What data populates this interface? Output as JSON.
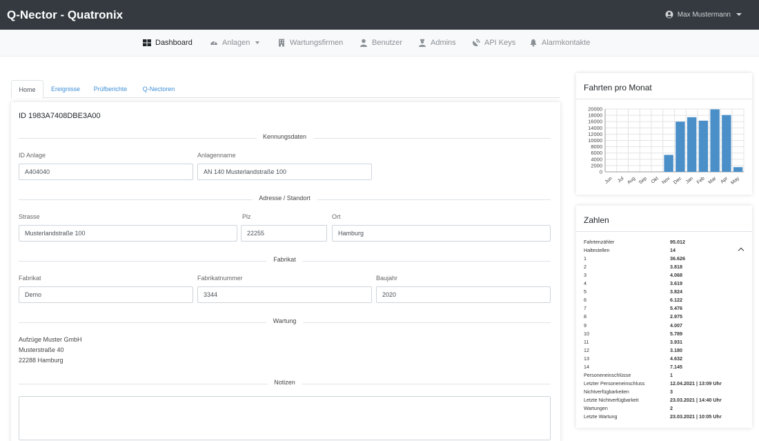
{
  "header": {
    "brand": "Q-Nector - Quatronix",
    "user_name": "Max Mustermann"
  },
  "nav": {
    "items": [
      {
        "label": "Dashboard",
        "icon": "dashboard-icon",
        "active": true
      },
      {
        "label": "Anlagen",
        "icon": "gauge-icon",
        "dropdown": true
      },
      {
        "label": "Wartungsfirmen",
        "icon": "building-icon"
      },
      {
        "label": "Benutzer",
        "icon": "user-icon"
      },
      {
        "label": "Admins",
        "icon": "admin-icon"
      },
      {
        "label": "API Keys",
        "icon": "satellite-icon"
      },
      {
        "label": "Alarmkontakte",
        "icon": "bell-icon"
      }
    ]
  },
  "tabs": [
    "Home",
    "Ereignisse",
    "Prüfberichte",
    "Q-Nectoren"
  ],
  "main": {
    "id_title": "ID 1983A7408DBE3A00",
    "sections": {
      "kennung": "Kennungsdaten",
      "adresse": "Adresse / Standort",
      "fabrikat": "Fabrikat",
      "wartung": "Wartung",
      "notizen": "Notizen"
    },
    "fields": {
      "id_anlage": {
        "label": "ID Anlage",
        "value": "A404040"
      },
      "anlagenname": {
        "label": "Anlagenname",
        "value": "AN 140 Musterlandstraße 100"
      },
      "strasse": {
        "label": "Strasse",
        "value": "Musterlandstraße 100"
      },
      "plz": {
        "label": "Plz",
        "value": "22255"
      },
      "ort": {
        "label": "Ort",
        "value": "Hamburg"
      },
      "fabrikat": {
        "label": "Fabrikat",
        "value": "Demo"
      },
      "fabrikatnummer": {
        "label": "Fabrikatnummer",
        "value": "3344"
      },
      "baujahr": {
        "label": "Baujahr",
        "value": "2020"
      }
    },
    "wartung": {
      "line1": "Aufzüge Muster GmbH",
      "line2": "Musterstraße 40",
      "line3": "22288 Hamburg"
    },
    "notizen_value": ""
  },
  "chart_card": {
    "title": "Fahrten pro Monat"
  },
  "chart_data": {
    "type": "bar",
    "categories": [
      "Jun",
      "Jul",
      "Aug",
      "Sep",
      "Okt",
      "Nov",
      "Dec",
      "Jan",
      "Feb",
      "Mar",
      "Apr",
      "May"
    ],
    "values": [
      0,
      0,
      0,
      0,
      0,
      5400,
      16000,
      17400,
      16300,
      19900,
      18100,
      1500
    ],
    "title": "",
    "xlabel": "",
    "ylabel": "",
    "ylim": [
      0,
      20000
    ],
    "yticks": [
      0,
      2000,
      4000,
      6000,
      8000,
      10000,
      12000,
      14000,
      16000,
      18000,
      20000
    ],
    "grid": true,
    "bar_color": "#4a8fc8"
  },
  "zahlen": {
    "title": "Zahlen",
    "rows": [
      {
        "k": "Fahrtenzähler",
        "v": "95.012"
      },
      {
        "k": "Haltestellen",
        "v": "14"
      },
      {
        "k": "1",
        "v": "36.626"
      },
      {
        "k": "2",
        "v": "3.818"
      },
      {
        "k": "3",
        "v": "4.068"
      },
      {
        "k": "4",
        "v": "3.619"
      },
      {
        "k": "5",
        "v": "3.824"
      },
      {
        "k": "6",
        "v": "6.122"
      },
      {
        "k": "7",
        "v": "5.476"
      },
      {
        "k": "8",
        "v": "2.975"
      },
      {
        "k": "9",
        "v": "4.007"
      },
      {
        "k": "10",
        "v": "5.789"
      },
      {
        "k": "11",
        "v": "3.931"
      },
      {
        "k": "12",
        "v": "3.180"
      },
      {
        "k": "13",
        "v": "4.632"
      },
      {
        "k": "14",
        "v": "7.145"
      },
      {
        "k": "Personeneinschlüsse",
        "v": "1"
      },
      {
        "k": "Letzter Personeneinschluss",
        "v": "12.04.2021 | 13:09 Uhr"
      },
      {
        "k": "Nichtverfügbarkeiten",
        "v": "3"
      },
      {
        "k": "Letzte Nichtverfügbarkeit",
        "v": "23.03.2021 | 14:40 Uhr"
      },
      {
        "k": "Wartungen",
        "v": "2"
      },
      {
        "k": "Letzte Wartung",
        "v": "23.03.2021 | 10:05 Uhr"
      }
    ]
  },
  "colors": {
    "topbar": "#343a40",
    "link": "#3f8fd6",
    "bar": "#4a8fc8"
  }
}
